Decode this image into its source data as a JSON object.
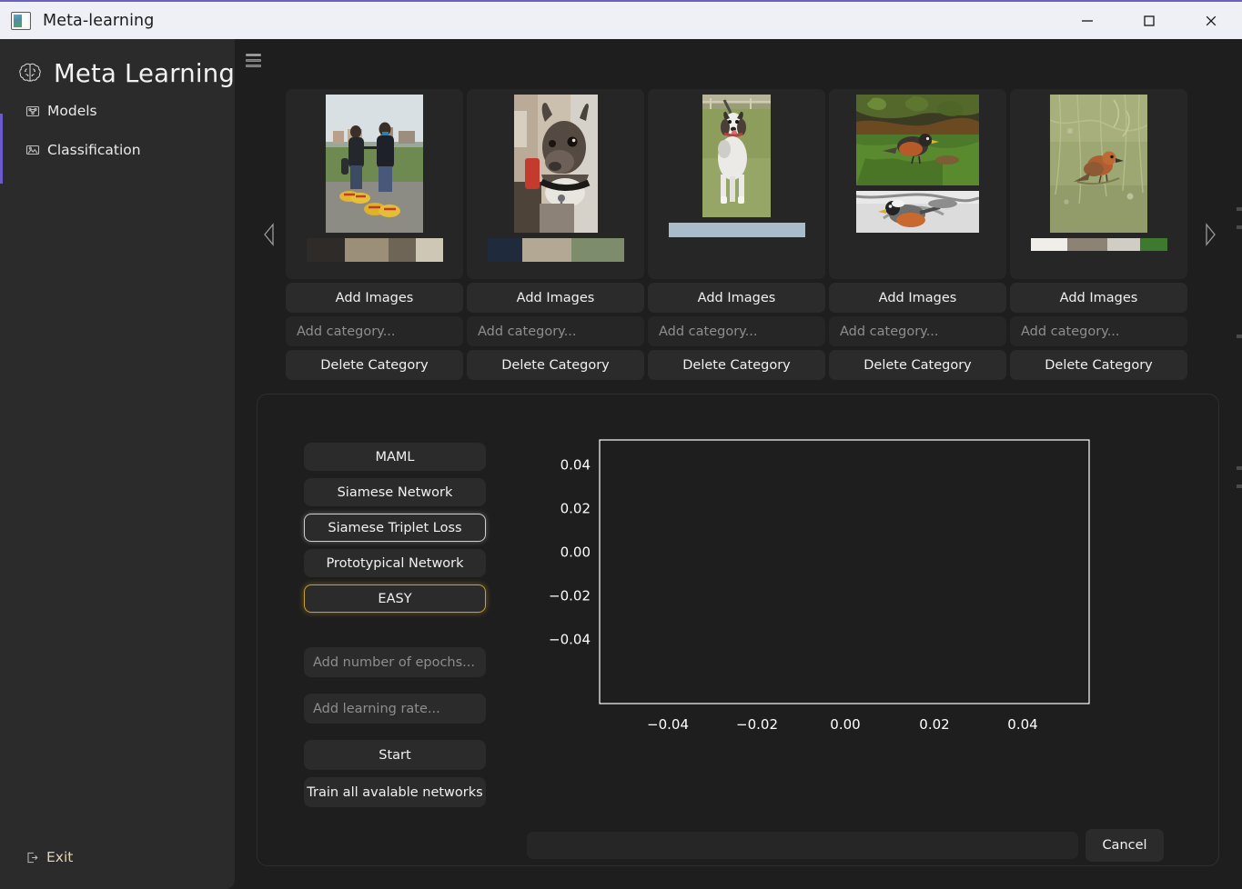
{
  "window": {
    "title": "Meta-learning",
    "icon": "app-window-icon",
    "controls": {
      "minimize": "minimize-icon",
      "maximize": "maximize-icon",
      "close": "close-icon"
    },
    "accent_color": "#6a5acd"
  },
  "sidebar": {
    "brand": {
      "label": "Meta Learning",
      "icon": "brain-icon"
    },
    "items": [
      {
        "id": "models",
        "label": "Models",
        "icon": "network-icon"
      },
      {
        "id": "classification",
        "label": "Classification",
        "icon": "image-classify-icon"
      }
    ],
    "exit": {
      "label": "Exit",
      "icon": "exit-icon",
      "color": "#ddd3b6"
    }
  },
  "main": {
    "menu_toggle": "hamburger-icon",
    "carousel": {
      "prev_icon": "chevron-left-icon",
      "next_icon": "chevron-right-icon",
      "add_images_label": "Add Images",
      "category_placeholder": "Add category...",
      "delete_category_label": "Delete Category",
      "cards": [
        {
          "id": "card-1",
          "category_value": "",
          "image_alt": "two-people-wooden-shoes"
        },
        {
          "id": "card-2",
          "category_value": "",
          "image_alt": "french-bulldog-portrait"
        },
        {
          "id": "card-3",
          "category_value": "",
          "image_alt": "hound-dog-on-grass"
        },
        {
          "id": "card-4",
          "category_value": "",
          "image_alt": "robin-on-grass"
        },
        {
          "id": "card-5",
          "category_value": "",
          "image_alt": "bird-in-tall-grass"
        }
      ]
    },
    "training": {
      "models": [
        {
          "id": "maml",
          "label": "MAML",
          "state": "normal"
        },
        {
          "id": "siamese-network",
          "label": "Siamese Network",
          "state": "normal"
        },
        {
          "id": "siamese-triplet-loss",
          "label": "Siamese Triplet Loss",
          "state": "hovered"
        },
        {
          "id": "prototypical-network",
          "label": "Prototypical Network",
          "state": "normal"
        },
        {
          "id": "easy",
          "label": "EASY",
          "state": "selected"
        }
      ],
      "epochs_placeholder": "Add number of epochs...",
      "epochs_value": "",
      "learning_rate_placeholder": "Add learning rate...",
      "learning_rate_value": "",
      "start_label": "Start",
      "train_all_label": "Train all avalable networks",
      "cancel_label": "Cancel",
      "progress_value": 0,
      "selected_color": "#c8a02e",
      "hovered_color": "#cfcfcf"
    }
  },
  "chart_data": {
    "type": "line",
    "title": "",
    "xlabel": "",
    "ylabel": "",
    "series": [],
    "x": [],
    "xlim": [
      -0.055,
      0.055
    ],
    "ylim": [
      -0.055,
      0.055
    ],
    "xticks": [
      -0.04,
      -0.02,
      0.0,
      0.02,
      0.04
    ],
    "xticklabels": [
      "−0.04",
      "−0.02",
      "0.00",
      "0.02",
      "0.04"
    ],
    "yticks": [
      -0.04,
      -0.02,
      0.0,
      0.02,
      0.04
    ],
    "yticklabels": [
      "−0.04",
      "−0.02",
      "0.00",
      "0.02",
      "0.04"
    ],
    "grid": false,
    "legend": false,
    "facecolor": "#1e1e1e",
    "spine_color": "#ffffff",
    "tick_color": "#ffffff",
    "note": "empty matplotlib axes - no data plotted"
  }
}
